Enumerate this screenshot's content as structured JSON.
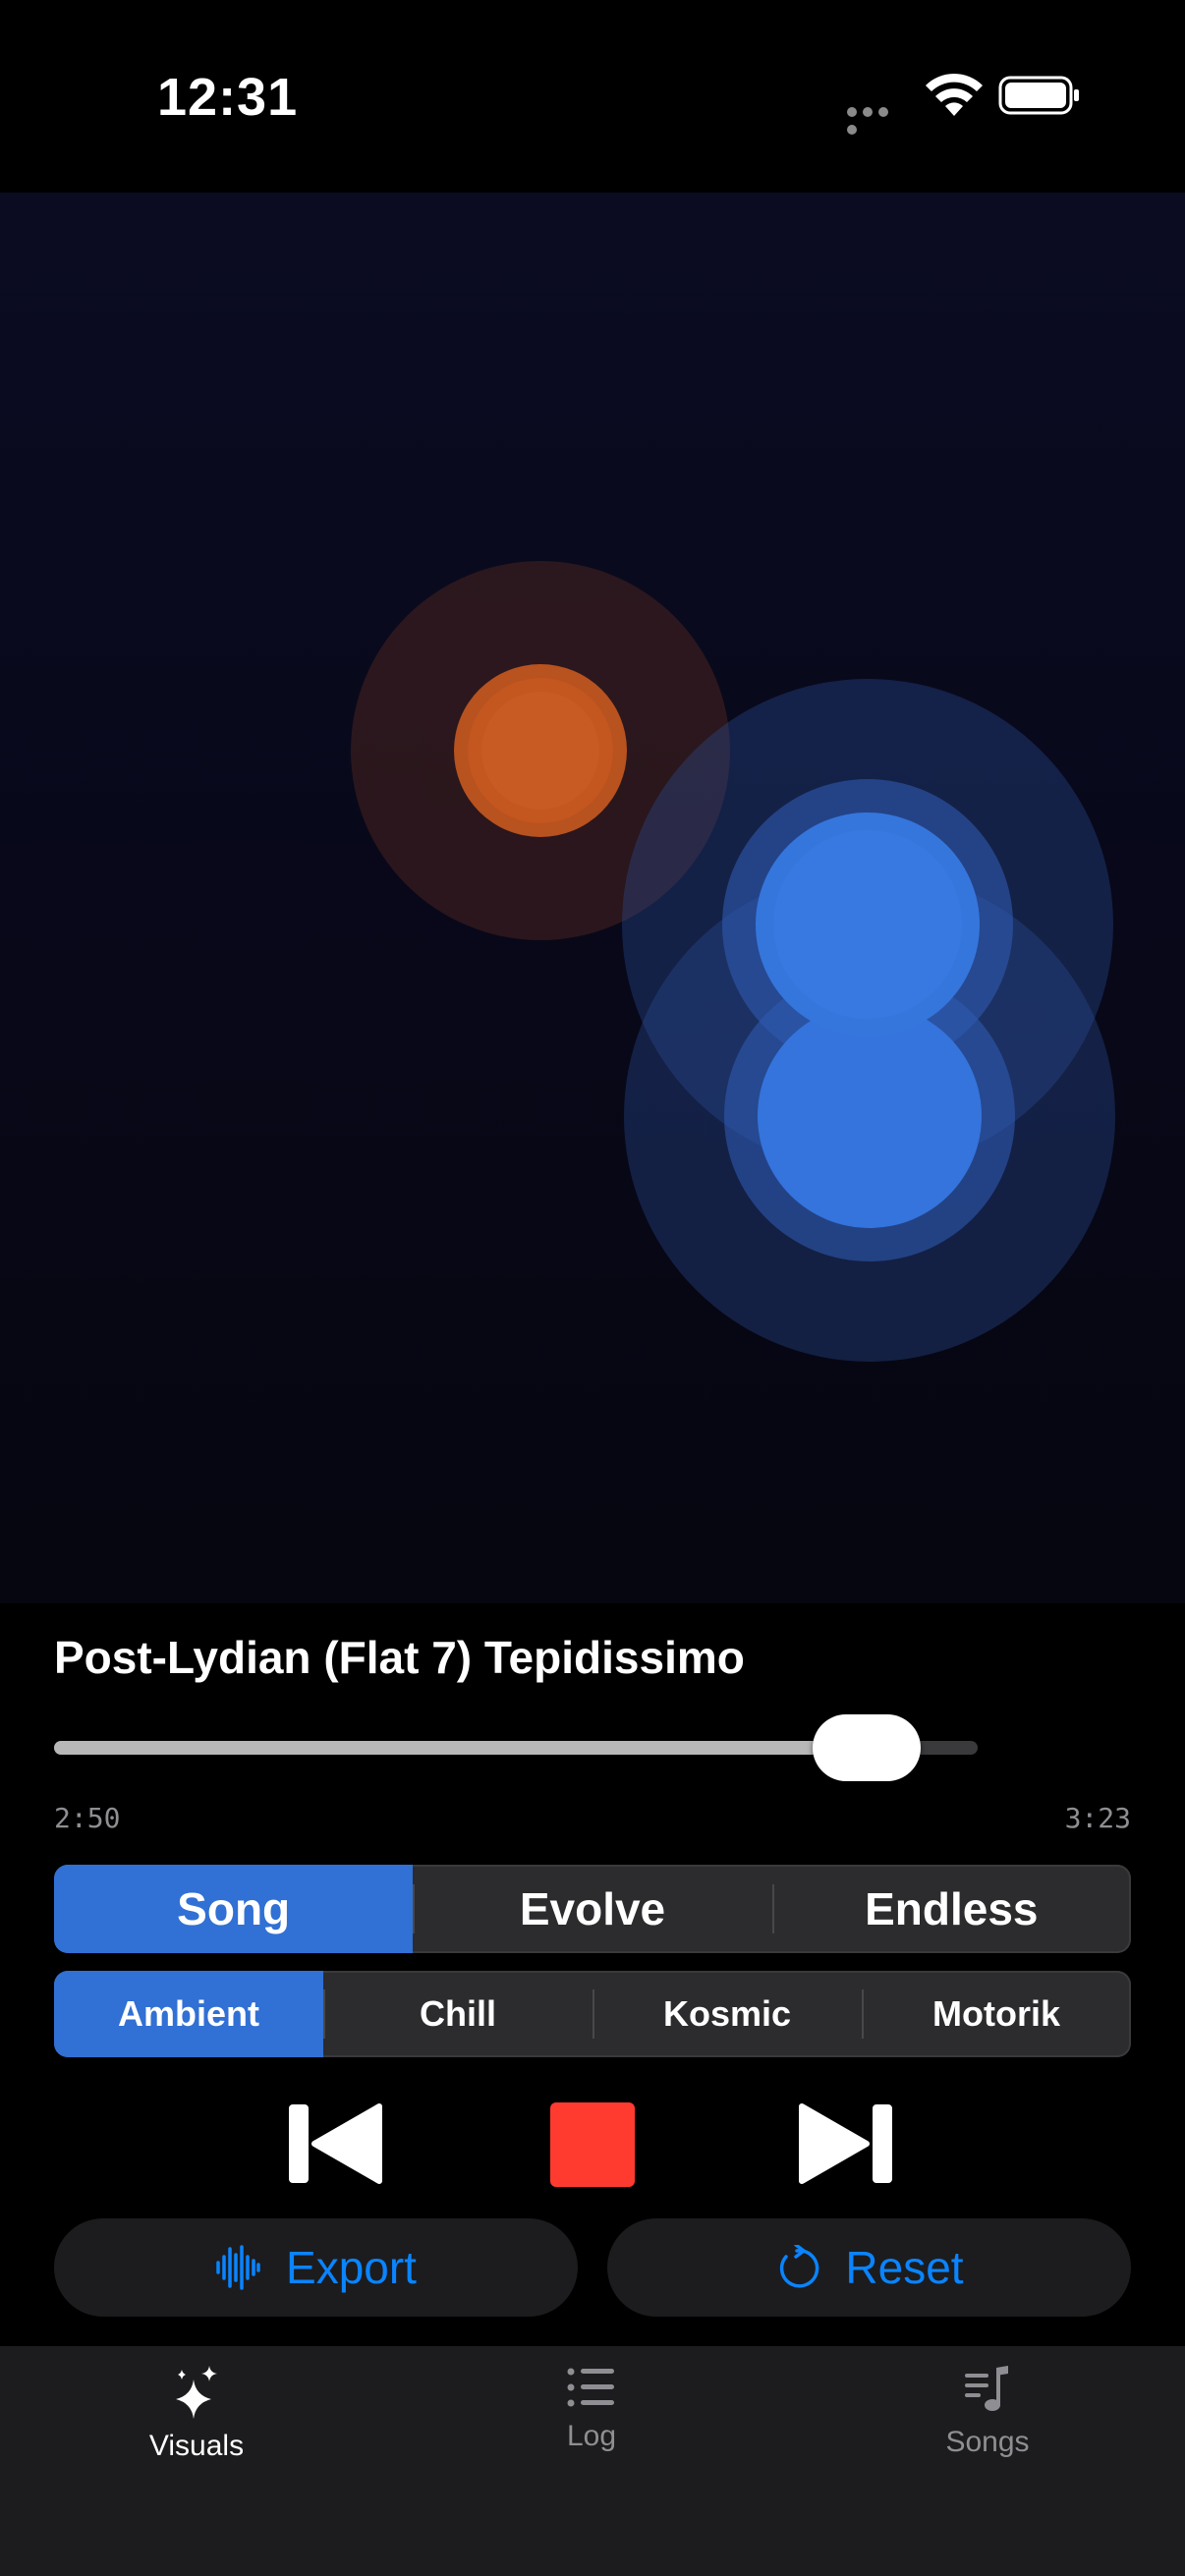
{
  "status_bar": {
    "time": "12:31"
  },
  "player": {
    "song_title": "Post-Lydian (Flat 7) Tepidissimo",
    "elapsed": "2:50",
    "duration": "3:23",
    "progress_fraction": 0.88
  },
  "mode_segments": {
    "items": [
      "Song",
      "Evolve",
      "Endless"
    ],
    "selected": "Song"
  },
  "style_segments": {
    "items": [
      "Ambient",
      "Chill",
      "Kosmic",
      "Motorik"
    ],
    "selected": "Ambient"
  },
  "actions": {
    "export_label": "Export",
    "reset_label": "Reset"
  },
  "tab_bar": {
    "items": [
      {
        "label": "Visuals",
        "icon": "sparkles-icon",
        "selected": true
      },
      {
        "label": "Log",
        "icon": "list-icon",
        "selected": false
      },
      {
        "label": "Songs",
        "icon": "music-list-icon",
        "selected": false
      }
    ]
  },
  "colors": {
    "accent": "#0a84ff",
    "segment_selected": "#3170d4",
    "stop": "#ff3b30",
    "orb_orange": "#c4561f",
    "orb_blue": "#3576dd"
  }
}
